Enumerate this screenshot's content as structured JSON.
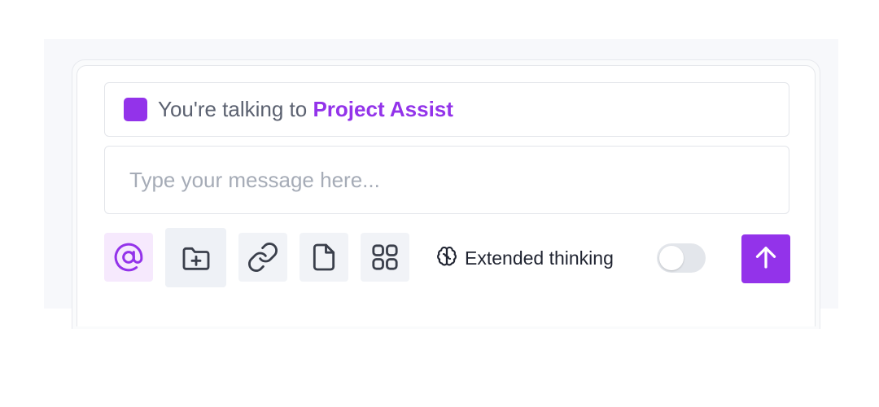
{
  "context": {
    "prefix": "You're talking to ",
    "agent_name": "Project Assist",
    "agent_color": "#9333ea"
  },
  "message": {
    "placeholder": "Type your message here...",
    "value": ""
  },
  "toolbar": {
    "tools": [
      {
        "icon": "at-sign-icon",
        "active": true
      },
      {
        "icon": "folder-plus-icon",
        "active": false
      },
      {
        "icon": "link-icon",
        "active": false
      },
      {
        "icon": "file-icon",
        "active": false
      },
      {
        "icon": "grid-icon",
        "active": false
      }
    ],
    "thinking_icon": "brain-icon",
    "thinking_label": "Extended thinking",
    "thinking_enabled": false,
    "send_icon": "arrow-up-icon"
  },
  "colors": {
    "accent": "#9333ea",
    "accent_soft": "#f6e9fd",
    "tool_bg": "#f1f3f7",
    "text_muted": "#5b6170",
    "placeholder": "#a6acb7"
  }
}
